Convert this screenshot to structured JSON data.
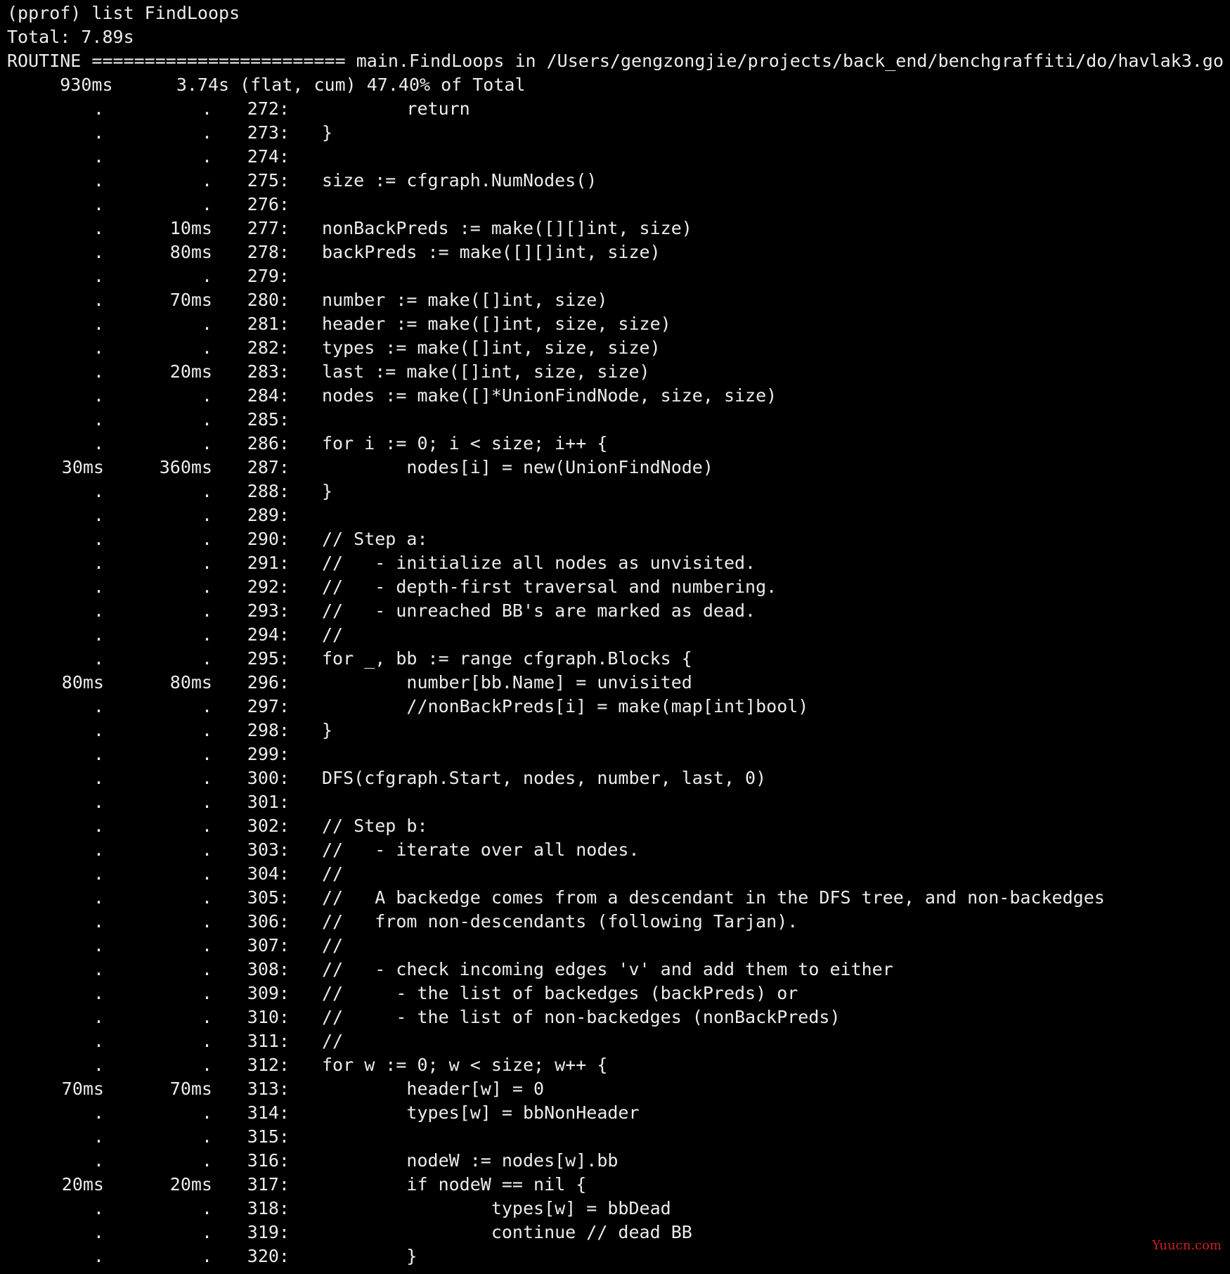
{
  "header": {
    "command": "(pprof) list FindLoops",
    "total": "Total: 7.89s",
    "routine": "ROUTINE ======================== main.FindLoops in /Users/gengzongjie/projects/back_end/benchgraffiti/do/havlak3.go",
    "summary": "     930ms      3.74s (flat, cum) 47.40% of Total"
  },
  "rows": [
    {
      "flat": ".",
      "cum": ".",
      "line": "272:",
      "code": "        return"
    },
    {
      "flat": ".",
      "cum": ".",
      "line": "273:",
      "code": "}"
    },
    {
      "flat": ".",
      "cum": ".",
      "line": "274:",
      "code": ""
    },
    {
      "flat": ".",
      "cum": ".",
      "line": "275:",
      "code": "size := cfgraph.NumNodes()"
    },
    {
      "flat": ".",
      "cum": ".",
      "line": "276:",
      "code": ""
    },
    {
      "flat": ".",
      "cum": "10ms",
      "line": "277:",
      "code": "nonBackPreds := make([][]int, size)"
    },
    {
      "flat": ".",
      "cum": "80ms",
      "line": "278:",
      "code": "backPreds := make([][]int, size)"
    },
    {
      "flat": ".",
      "cum": ".",
      "line": "279:",
      "code": ""
    },
    {
      "flat": ".",
      "cum": "70ms",
      "line": "280:",
      "code": "number := make([]int, size)"
    },
    {
      "flat": ".",
      "cum": ".",
      "line": "281:",
      "code": "header := make([]int, size, size)"
    },
    {
      "flat": ".",
      "cum": ".",
      "line": "282:",
      "code": "types := make([]int, size, size)"
    },
    {
      "flat": ".",
      "cum": "20ms",
      "line": "283:",
      "code": "last := make([]int, size, size)"
    },
    {
      "flat": ".",
      "cum": ".",
      "line": "284:",
      "code": "nodes := make([]*UnionFindNode, size, size)"
    },
    {
      "flat": ".",
      "cum": ".",
      "line": "285:",
      "code": ""
    },
    {
      "flat": ".",
      "cum": ".",
      "line": "286:",
      "code": "for i := 0; i < size; i++ {"
    },
    {
      "flat": "30ms",
      "cum": "360ms",
      "line": "287:",
      "code": "        nodes[i] = new(UnionFindNode)"
    },
    {
      "flat": ".",
      "cum": ".",
      "line": "288:",
      "code": "}"
    },
    {
      "flat": ".",
      "cum": ".",
      "line": "289:",
      "code": ""
    },
    {
      "flat": ".",
      "cum": ".",
      "line": "290:",
      "code": "// Step a:"
    },
    {
      "flat": ".",
      "cum": ".",
      "line": "291:",
      "code": "//   - initialize all nodes as unvisited."
    },
    {
      "flat": ".",
      "cum": ".",
      "line": "292:",
      "code": "//   - depth-first traversal and numbering."
    },
    {
      "flat": ".",
      "cum": ".",
      "line": "293:",
      "code": "//   - unreached BB's are marked as dead."
    },
    {
      "flat": ".",
      "cum": ".",
      "line": "294:",
      "code": "//"
    },
    {
      "flat": ".",
      "cum": ".",
      "line": "295:",
      "code": "for _, bb := range cfgraph.Blocks {"
    },
    {
      "flat": "80ms",
      "cum": "80ms",
      "line": "296:",
      "code": "        number[bb.Name] = unvisited"
    },
    {
      "flat": ".",
      "cum": ".",
      "line": "297:",
      "code": "        //nonBackPreds[i] = make(map[int]bool)"
    },
    {
      "flat": ".",
      "cum": ".",
      "line": "298:",
      "code": "}"
    },
    {
      "flat": ".",
      "cum": ".",
      "line": "299:",
      "code": ""
    },
    {
      "flat": ".",
      "cum": ".",
      "line": "300:",
      "code": "DFS(cfgraph.Start, nodes, number, last, 0)"
    },
    {
      "flat": ".",
      "cum": ".",
      "line": "301:",
      "code": ""
    },
    {
      "flat": ".",
      "cum": ".",
      "line": "302:",
      "code": "// Step b:"
    },
    {
      "flat": ".",
      "cum": ".",
      "line": "303:",
      "code": "//   - iterate over all nodes."
    },
    {
      "flat": ".",
      "cum": ".",
      "line": "304:",
      "code": "//"
    },
    {
      "flat": ".",
      "cum": ".",
      "line": "305:",
      "code": "//   A backedge comes from a descendant in the DFS tree, and non-backedges"
    },
    {
      "flat": ".",
      "cum": ".",
      "line": "306:",
      "code": "//   from non-descendants (following Tarjan)."
    },
    {
      "flat": ".",
      "cum": ".",
      "line": "307:",
      "code": "//"
    },
    {
      "flat": ".",
      "cum": ".",
      "line": "308:",
      "code": "//   - check incoming edges 'v' and add them to either"
    },
    {
      "flat": ".",
      "cum": ".",
      "line": "309:",
      "code": "//     - the list of backedges (backPreds) or"
    },
    {
      "flat": ".",
      "cum": ".",
      "line": "310:",
      "code": "//     - the list of non-backedges (nonBackPreds)"
    },
    {
      "flat": ".",
      "cum": ".",
      "line": "311:",
      "code": "//"
    },
    {
      "flat": ".",
      "cum": ".",
      "line": "312:",
      "code": "for w := 0; w < size; w++ {"
    },
    {
      "flat": "70ms",
      "cum": "70ms",
      "line": "313:",
      "code": "        header[w] = 0"
    },
    {
      "flat": ".",
      "cum": ".",
      "line": "314:",
      "code": "        types[w] = bbNonHeader"
    },
    {
      "flat": ".",
      "cum": ".",
      "line": "315:",
      "code": ""
    },
    {
      "flat": ".",
      "cum": ".",
      "line": "316:",
      "code": "        nodeW := nodes[w].bb"
    },
    {
      "flat": "20ms",
      "cum": "20ms",
      "line": "317:",
      "code": "        if nodeW == nil {"
    },
    {
      "flat": ".",
      "cum": ".",
      "line": "318:",
      "code": "                types[w] = bbDead"
    },
    {
      "flat": ".",
      "cum": ".",
      "line": "319:",
      "code": "                continue // dead BB"
    },
    {
      "flat": ".",
      "cum": ".",
      "line": "320:",
      "code": "        }"
    }
  ],
  "watermark": "Yuucn.com"
}
